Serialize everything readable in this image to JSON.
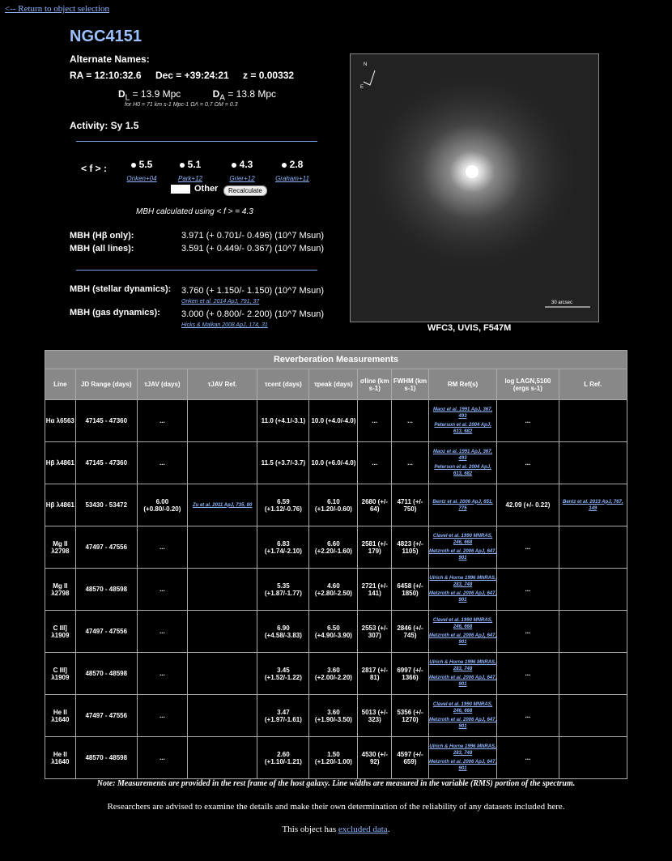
{
  "nav": {
    "back_link": "<-- Return to object selection"
  },
  "object": {
    "name": "NGC4151",
    "alt_names_label": "Alternate Names:",
    "ra": "RA = 12:10:32.6",
    "dec": "Dec = +39:24:21",
    "z": "z = 0.00332",
    "dl_label": "D",
    "dl_sub": "L",
    "dl_value": "= 13.9 Mpc",
    "da_label": "D",
    "da_sub": "A",
    "da_value": "= 13.8 Mpc",
    "cosmology": "for H0 = 71 km s-1 Mpc-1  ΩΛ = 0.7  ΩM = 0.3",
    "activity": "Activity: Sy 1.5"
  },
  "f_factor": {
    "label": "< f > :",
    "options": [
      {
        "value": "5.5",
        "ref": "Onken+04"
      },
      {
        "value": "5.1",
        "ref": "Park+12"
      },
      {
        "value": "4.3",
        "ref": "Grier+12"
      },
      {
        "value": "2.8",
        "ref": "Graham+11"
      }
    ],
    "other_label": "Other",
    "recalc_label": "Recalculate",
    "calc_note": "MBH calculated using < f > = 4.3"
  },
  "mbh": {
    "hbeta_label": "MBH (Hβ only):",
    "hbeta_value": "3.971 (+ 0.701/- 0.496)   (10^7 Msun)",
    "all_label": "MBH (all lines):",
    "all_value": "3.591 (+ 0.449/- 0.367)   (10^7 Msun)",
    "stellar_label": "MBH (stellar dynamics):",
    "stellar_value": "3.760 (+ 1.150/- 1.150)   (10^7 Msun)",
    "stellar_ref": "Onken et al. 2014 ApJ, 791, 37",
    "gas_label": "MBH (gas dynamics):",
    "gas_value": "3.000 (+ 0.800/- 2.200)   (10^7 Msun)",
    "gas_ref": "Hicks & Malkan 2008 ApJ, 174, 31"
  },
  "image": {
    "caption": "WFC3, UVIS, F547M",
    "compass_n": "N",
    "compass_e": "E",
    "scale_label": "30 arcsec"
  },
  "table": {
    "caption": "Reverberation Measurements",
    "headers": [
      "Line",
      "JD Range (days)",
      "τJAV (days)",
      "τJAV Ref.",
      "τcent (days)",
      "τpeak (days)",
      "σline (km s-1)",
      "FWHM (km s-1)",
      "RM Ref(s)",
      "log LAGN,5100 (ergs s-1)",
      "L Ref."
    ],
    "rows": [
      {
        "line": "Hα λ6563",
        "jd": "47145 - 47360",
        "tjav": "...",
        "tjav_ref": "",
        "tcent": "11.0 (+4.1/-3.1)",
        "tpeak": "10.0 (+4.0/-4.0)",
        "sigma": "...",
        "fwhm": "...",
        "rm_refs": [
          "Maoz et al. 1991 ApJ, 367, 493",
          "Peterson et al. 2004 ApJ, 613, 682"
        ],
        "logl": "...",
        "lref": ""
      },
      {
        "line": "Hβ λ4861",
        "jd": "47145 - 47360",
        "tjav": "...",
        "tjav_ref": "",
        "tcent": "11.5 (+3.7/-3.7)",
        "tpeak": "10.0 (+6.0/-4.0)",
        "sigma": "...",
        "fwhm": "...",
        "rm_refs": [
          "Maoz et al. 1991 ApJ, 367, 493",
          "Peterson et al. 2004 ApJ, 613, 682"
        ],
        "logl": "...",
        "lref": ""
      },
      {
        "line": "Hβ λ4861",
        "jd": "53430 - 53472",
        "tjav": "6.00 (+0.80/-0.20)",
        "tjav_ref": "Zu et al. 2011 ApJ, 735, 80",
        "tcent": "6.59 (+1.12/-0.76)",
        "tpeak": "6.10 (+1.20/-0.60)",
        "sigma": "2680 (+/- 64)",
        "fwhm": "4711 (+/- 750)",
        "rm_refs": [
          "Bentz et al. 2006 ApJ, 651, 775"
        ],
        "logl": "42.09 (+/- 0.22)",
        "lref": "Bentz et al. 2013 ApJ, 767, 149"
      },
      {
        "line": "Mg II λ2798",
        "jd": "47497 - 47556",
        "tjav": "...",
        "tjav_ref": "",
        "tcent": "6.83 (+1.74/-2.10)",
        "tpeak": "6.60 (+2.20/-1.60)",
        "sigma": "2581 (+/- 179)",
        "fwhm": "4823 (+/- 1105)",
        "rm_refs": [
          "Clavel et al. 1990 MNRAS, 246, 668",
          "Metzroth et al. 2006 ApJ, 647, 901"
        ],
        "logl": "...",
        "lref": ""
      },
      {
        "line": "Mg II λ2798",
        "jd": "48570 - 48598",
        "tjav": "...",
        "tjav_ref": "",
        "tcent": "5.35 (+1.87/-1.77)",
        "tpeak": "4.60 (+2.80/-2.50)",
        "sigma": "2721 (+/- 141)",
        "fwhm": "6458 (+/- 1850)",
        "rm_refs": [
          "Ulrich & Horne 1996 MNRAS, 283, 748",
          "Metzroth et al. 2006 ApJ, 647, 901"
        ],
        "logl": "...",
        "lref": ""
      },
      {
        "line": "C III] λ1909",
        "jd": "47497 - 47556",
        "tjav": "...",
        "tjav_ref": "",
        "tcent": "6.90 (+4.58/-3.83)",
        "tpeak": "6.50 (+4.90/-3.90)",
        "sigma": "2553 (+/- 307)",
        "fwhm": "2846 (+/- 745)",
        "rm_refs": [
          "Clavel et al. 1990 MNRAS, 246, 668",
          "Metzroth et al. 2006 ApJ, 647, 901"
        ],
        "logl": "...",
        "lref": ""
      },
      {
        "line": "C III] λ1909",
        "jd": "48570 - 48598",
        "tjav": "...",
        "tjav_ref": "",
        "tcent": "3.45 (+1.52/-1.22)",
        "tpeak": "3.60 (+2.00/-2.20)",
        "sigma": "2817 (+/- 81)",
        "fwhm": "6997 (+/- 1366)",
        "rm_refs": [
          "Ulrich & Horne 1996 MNRAS, 283, 748",
          "Metzroth et al. 2006 ApJ, 647, 901"
        ],
        "logl": "...",
        "lref": ""
      },
      {
        "line": "He II λ1640",
        "jd": "47497 - 47556",
        "tjav": "...",
        "tjav_ref": "",
        "tcent": "3.47 (+1.97/-1.61)",
        "tpeak": "3.60 (+1.90/-3.50)",
        "sigma": "5013 (+/- 323)",
        "fwhm": "5356 (+/- 1270)",
        "rm_refs": [
          "Clavel et al. 1990 MNRAS, 246, 668",
          "Metzroth et al. 2006 ApJ, 647, 901"
        ],
        "logl": "...",
        "lref": ""
      },
      {
        "line": "He II λ1640",
        "jd": "48570 - 48598",
        "tjav": "...",
        "tjav_ref": "",
        "tcent": "2.60 (+1.10/-1.21)",
        "tpeak": "1.50 (+1.20/-1.00)",
        "sigma": "4530 (+/- 92)",
        "fwhm": "4597 (+/- 659)",
        "rm_refs": [
          "Ulrich & Horne 1996 MNRAS, 283, 748",
          "Metzroth et al. 2006 ApJ, 647, 901"
        ],
        "logl": "...",
        "lref": ""
      }
    ]
  },
  "footer": {
    "note": "Note: Measurements are provided in the rest frame of the host galaxy. Line widths are measured in the variable (RMS) portion of the spectrum.",
    "advice": "Researchers are advised to examine the details and make their own determination of the reliability of any datasets included here.",
    "excluded_prefix": "This object has ",
    "excluded_link": "excluded data",
    "excluded_suffix": "."
  }
}
